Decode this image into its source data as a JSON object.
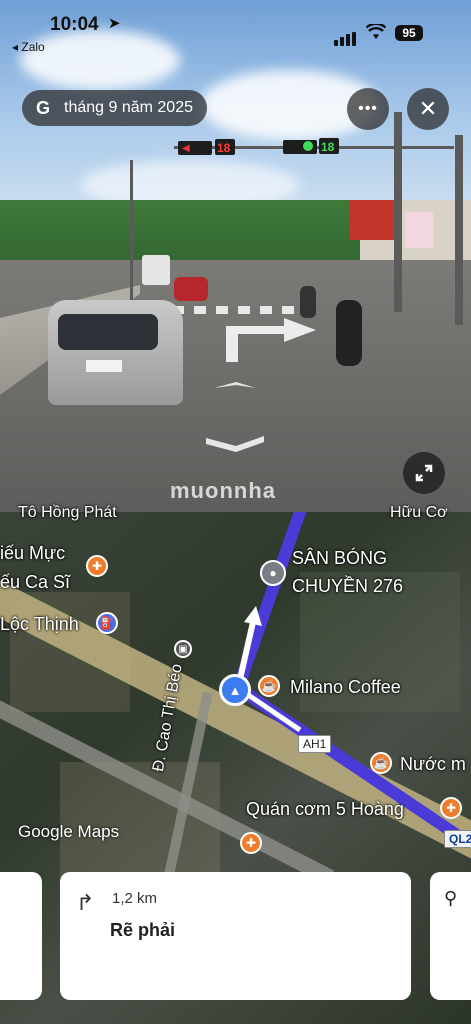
{
  "status_bar": {
    "time": "10:04",
    "back_label": "◂ Zalo",
    "battery": "95"
  },
  "street_view": {
    "date_label": "tháng 9 năm 2025",
    "google_glyph": "G",
    "traffic_timer_left": "18",
    "traffic_timer_right": "18",
    "more_icon": "more-horizontal-icon",
    "close_icon": "close-icon",
    "expand_icon": "expand-icon"
  },
  "map": {
    "labels": {
      "top_left": "Tô Hồng Phát",
      "top_right": "Hữu Cơ",
      "muc": "iếu Mực",
      "casi": "ếu Ca Sĩ",
      "locthinh": "Lộc Thịnh",
      "sanbong1": "SÂN BÓNG",
      "sanbong2": "CHUYỀN 276",
      "milano": "Milano Coffee",
      "nuoc": "Nước m",
      "quancom": "Quán cơm 5 Hoàng",
      "caothibeo": "Đ. Cao Thị Béo"
    },
    "road_tags": {
      "ah1": "AH1",
      "ql": "QL2"
    },
    "watermark": "muonnha",
    "google_maps": "Google Maps"
  },
  "navigation": {
    "distance": "1,2 km",
    "instruction": "Rẽ phải",
    "turn_icon": "turn-right-icon"
  }
}
